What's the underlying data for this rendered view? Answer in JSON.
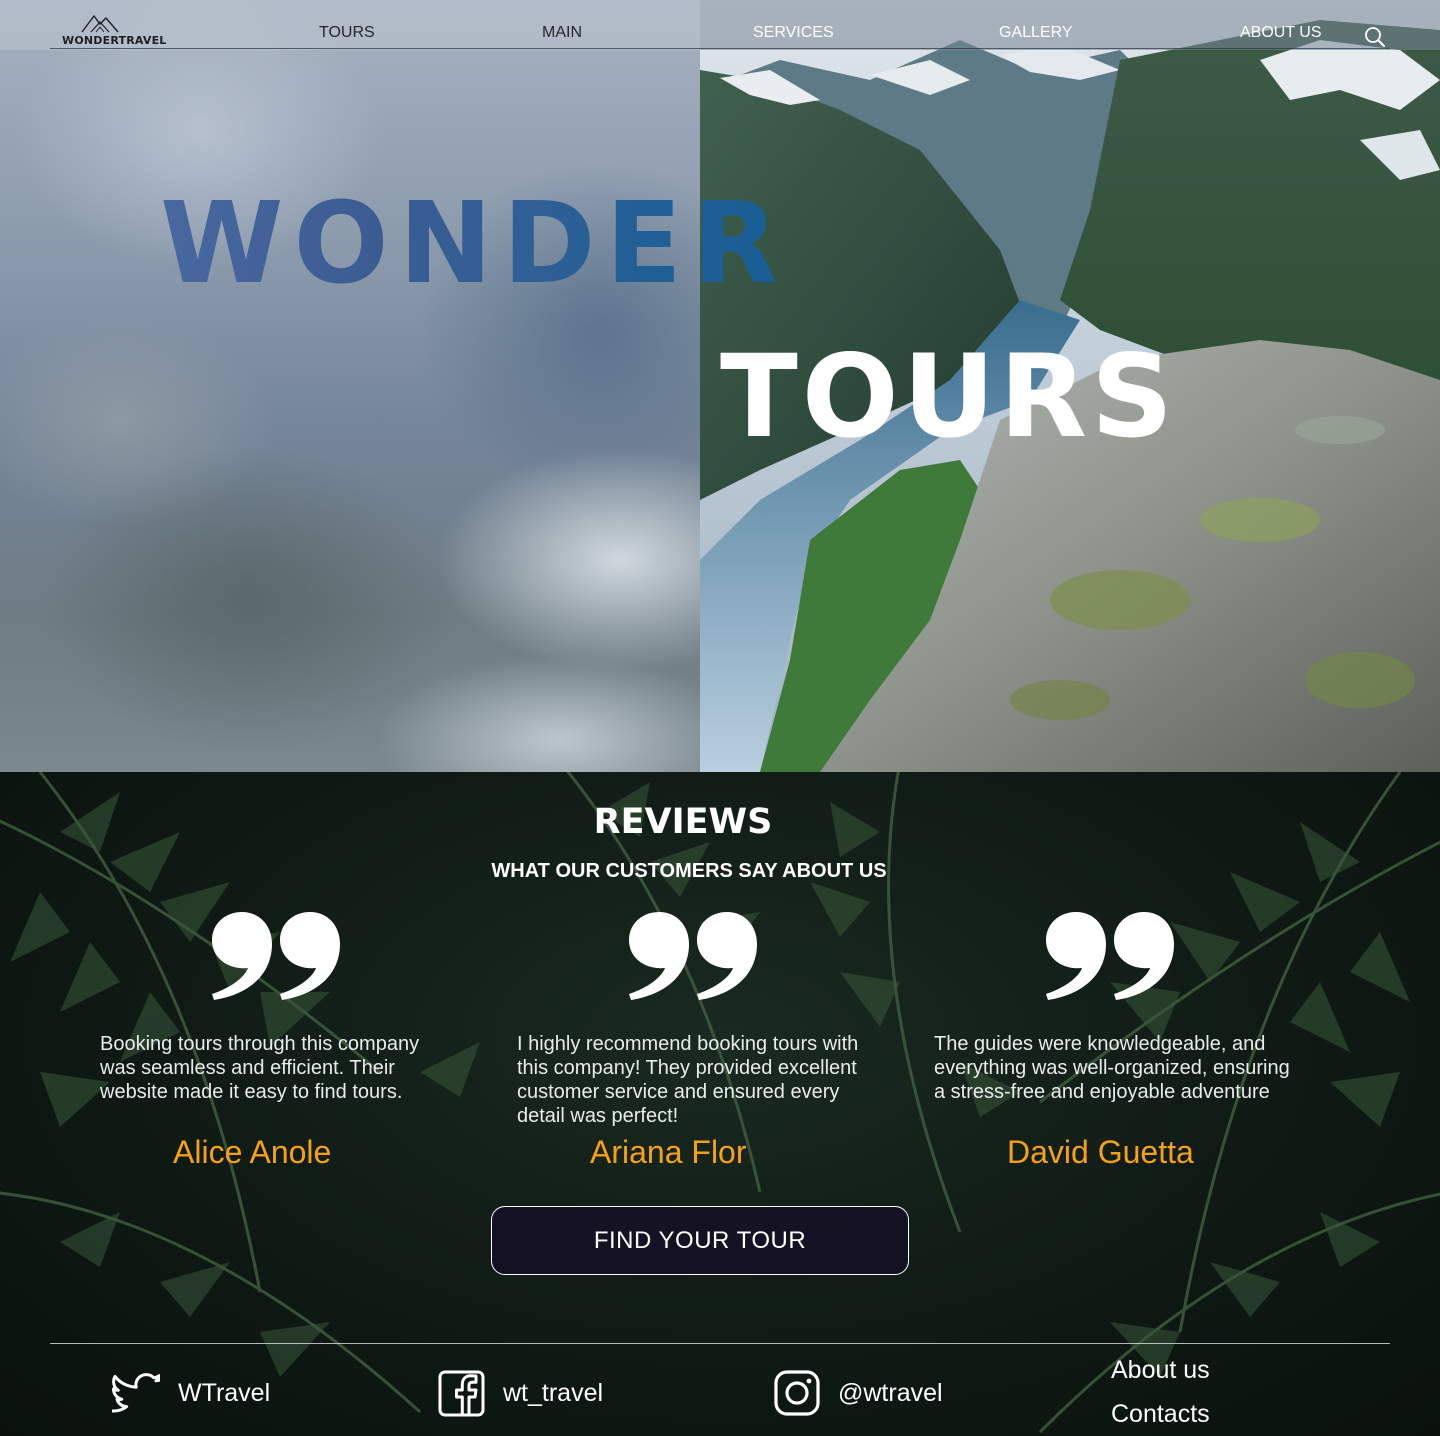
{
  "brand": {
    "logo_text": "WONDERTRAVEL"
  },
  "nav": {
    "items": [
      {
        "label": "TOURS"
      },
      {
        "label": "MAIN"
      },
      {
        "label": "SERVICES"
      },
      {
        "label": "GALLERY"
      },
      {
        "label": "ABOUT US"
      }
    ],
    "search_icon": "search-icon"
  },
  "hero": {
    "title_part1": "WONDER",
    "title_part2": "TOURS"
  },
  "reviews": {
    "heading": "REVIEWS",
    "subheading": "WHAT OUR CUSTOMERS SAY ABOUT US",
    "quote_icon": "quote-icon",
    "items": [
      {
        "text": "Booking tours through this company was seamless and efficient. Their website made it easy to find tours.",
        "author": "Alice Anole"
      },
      {
        "text": "I highly recommend booking tours with this company! They provided excellent customer service and ensured every detail was perfect!",
        "author": "Ariana Flor"
      },
      {
        "text": "The guides were knowledgeable, and everything was well-organized, ensuring a stress-free and enjoyable adventure",
        "author": "David Guetta"
      }
    ],
    "cta_label": "FIND YOUR TOUR"
  },
  "footer": {
    "social": [
      {
        "icon": "twitter-icon",
        "label": "WTravel"
      },
      {
        "icon": "facebook-icon",
        "label": "wt_travel"
      },
      {
        "icon": "instagram-icon",
        "label": "@wtravel"
      }
    ],
    "links": [
      {
        "label": "About us"
      },
      {
        "label": "Contacts"
      }
    ]
  },
  "colors": {
    "accent": "#f5a11c",
    "text_light": "#ffffff"
  }
}
